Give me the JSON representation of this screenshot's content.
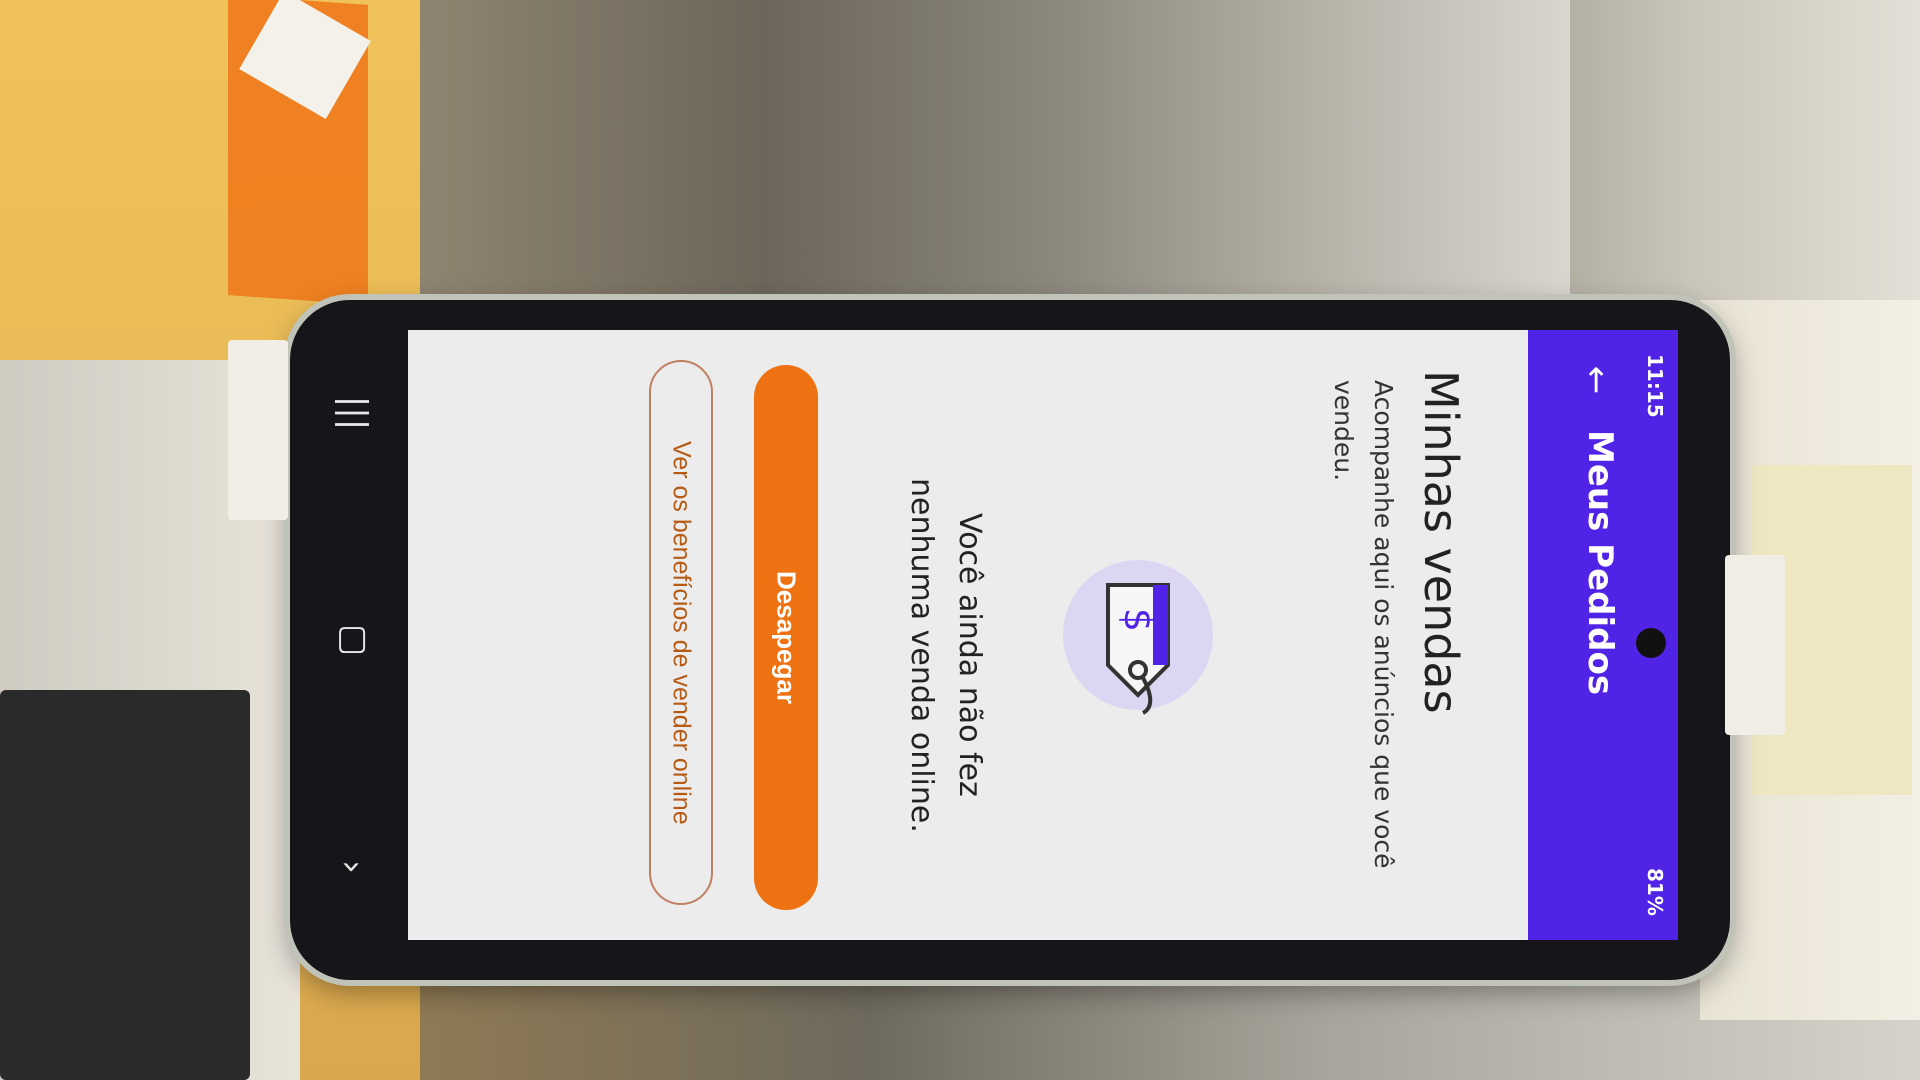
{
  "status_bar": {
    "time": "11:15",
    "battery": "81%"
  },
  "toolbar": {
    "title": "Meus Pedidos",
    "back_icon": "arrow-back-icon"
  },
  "main": {
    "title": "Minhas vendas",
    "subtitle": "Acompanhe aqui os anúncios que você vendeu.",
    "illustration_icon": "price-tag-dollar-icon",
    "empty_message": "Você ainda não fez nenhuma venda online.",
    "primary_button": "Desapegar",
    "secondary_button": "Ver os benefícios de vender online"
  },
  "colors": {
    "toolbar": "#5123e6",
    "accent": "#ef7212"
  }
}
